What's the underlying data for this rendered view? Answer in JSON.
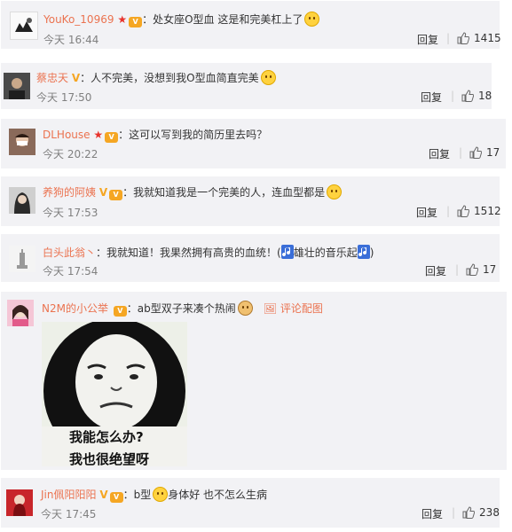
{
  "accent": "#eb7350",
  "comments": [
    {
      "username": "YouKo_10969",
      "badges": [
        "star-icon",
        "vip-icon"
      ],
      "text": "：处女座O型血 这是和完美杠上了",
      "emoji": "grin-emoji-icon",
      "time": "今天 16:44",
      "reply": "回复",
      "likes": "1415"
    },
    {
      "username": "蔡忠天",
      "badges": [
        "verified-v-icon"
      ],
      "text": "：人不完美，没想到我O型血简直完美",
      "emoji": "peace-emoji-icon",
      "time": "今天 17:50",
      "reply": "回复",
      "likes": "18"
    },
    {
      "username": "DLHouse",
      "badges": [
        "star-icon",
        "vip-icon"
      ],
      "text": "：这可以写到我的简历里去吗？",
      "time": "今天 20:22",
      "reply": "回复",
      "likes": "17"
    },
    {
      "username": "养狗的阿姨",
      "badges": [
        "verified-v-icon",
        "vip-icon"
      ],
      "text": "：我就知道我是一个完美的人，连血型都是",
      "emoji": "cat-emoji-icon",
      "time": "今天 17:53",
      "reply": "回复",
      "likes": "1512"
    },
    {
      "username": "白头此翁丶",
      "text": "：我就知道！我果然拥有高贵的血统！(",
      "text_mid": "雄壮的音乐起",
      "text_end": ")",
      "time": "今天 17:54",
      "reply": "回复",
      "likes": "17"
    },
    {
      "username": "N2M的小公举",
      "badges": [
        "vip-icon"
      ],
      "text": "：ab型双子来凑个热闹",
      "emoji": "doge-emoji-icon",
      "picture_link": "评论配图",
      "meme": {
        "caption1": "我能怎么办?",
        "caption2": "我也很绝望呀"
      }
    },
    {
      "username": "Jin佩阳阳阳",
      "badges": [
        "verified-v-icon",
        "vip-icon"
      ],
      "text_pre": "：b型",
      "emoji": "cat-emoji-icon",
      "text": "身体好 也不怎么生病",
      "time": "今天 17:45",
      "reply": "回复",
      "likes": "238"
    }
  ]
}
